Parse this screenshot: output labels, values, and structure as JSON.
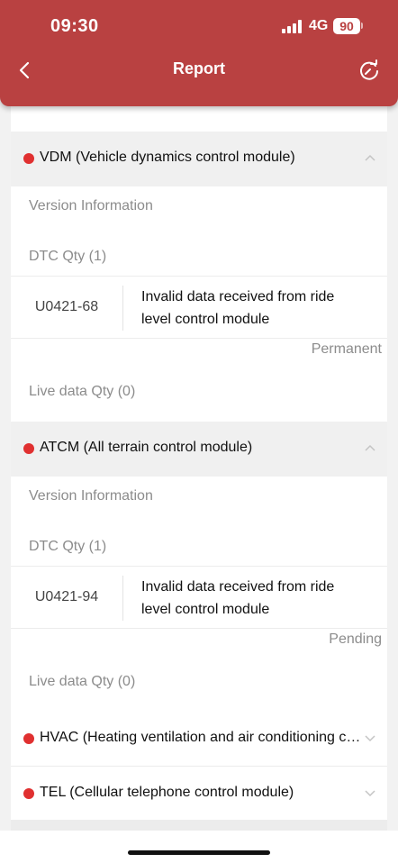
{
  "status_bar": {
    "time": "09:30",
    "network": "4G",
    "battery": "90"
  },
  "header": {
    "title": "Report"
  },
  "modules": [
    {
      "name": "VDM (Vehicle dynamics control module)",
      "version_label": "Version Information",
      "dtc_label": "DTC Qty (1)",
      "dtc": {
        "code": "U0421-68",
        "description": "Invalid data received from ride level control module",
        "status": "Permanent"
      },
      "live_label": "Live data Qty (0)"
    },
    {
      "name": "ATCM (All terrain control module)",
      "version_label": "Version Information",
      "dtc_label": "DTC Qty (1)",
      "dtc": {
        "code": "U0421-94",
        "description": "Invalid data received from ride level control module",
        "status": "Pending"
      },
      "live_label": "Live data Qty (0)"
    },
    {
      "name": "HVAC (Heating ventilation and air conditioning c…"
    },
    {
      "name": "TEL (Cellular telephone control module)"
    }
  ],
  "colors": {
    "brand": "#b94141",
    "fault_dot": "#e03030"
  },
  "icons": {
    "back": "chevron-left-icon",
    "refresh": "refresh-icon",
    "expanded": "chevron-up-icon",
    "collapsed": "chevron-down-icon"
  }
}
